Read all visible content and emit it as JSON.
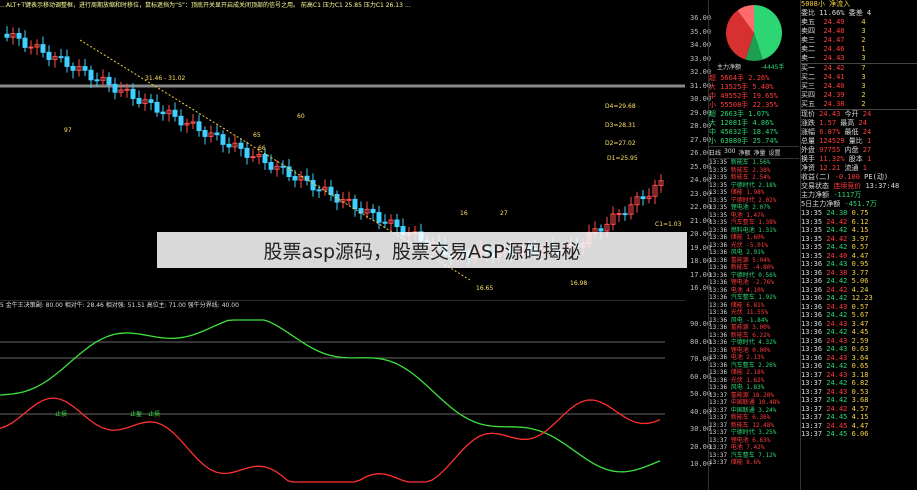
{
  "main_legend": "…ALT+T键表示移动调整框，进行周期放缩和时移位，鼠标遮挡为“S”：顶底开关显开启成关闭顶部的信号之用。 前高C1  压力C1 25.85  压力C1 26.13  …",
  "main_y_ticks": [
    "36.00",
    "35.00",
    "34.00",
    "33.00",
    "32.00",
    "31.00",
    "30.00",
    "29.00",
    "28.00",
    "27.00",
    "26.00",
    "25.00",
    "24.00",
    "23.00",
    "22.00",
    "21.00",
    "20.00",
    "19.00",
    "18.00",
    "17.00",
    "16.00"
  ],
  "main_annotations": [
    "31.46 - 31.02",
    "97",
    "66",
    "60",
    "65",
    "27",
    "16.65",
    "16",
    "16.98",
    "D4=29.68",
    "D3=28.31",
    "D2=27.02",
    "D1=25.95",
    "C1=1.03"
  ],
  "osc_legend": "5 金牛王决策副: 80.00  相对牛: 28.46  相对强: 51.51  高位主: 71.00  强牛分界线: 40.00",
  "osc_y_ticks": [
    "90.00",
    "80.00",
    "70.00",
    "60.00",
    "50.00",
    "40.00",
    "30.00",
    "20.00",
    "10.00"
  ],
  "osc_labels": [
    "止损",
    "止盈",
    "止损"
  ],
  "banner_text": "股票asp源码，股票交易ASP源码揭秘",
  "pie": {
    "labels": [
      "主力净额",
      "-4445手"
    ]
  },
  "flow": [
    {
      "k": "超",
      "v": "5664手",
      "p": "2.26%"
    },
    {
      "k": "大",
      "v": "13525手",
      "p": "5.40%"
    },
    {
      "k": "中",
      "v": "49552手",
      "p": "19.65%"
    },
    {
      "k": "小",
      "v": "55508手",
      "p": "22.35%"
    },
    {
      "k": "超",
      "v": "2663手",
      "p": "1.07%"
    },
    {
      "k": "大",
      "v": "12081手",
      "p": "4.86%"
    },
    {
      "k": "中",
      "v": "45832手",
      "p": "18.47%"
    },
    {
      "k": "小",
      "v": "63880手",
      "p": "25.74%"
    }
  ],
  "flow_tabs": [
    "日线",
    "300",
    "净额",
    "净量",
    "设置"
  ],
  "ticks": [
    {
      "t": "13:35",
      "v": "新能车",
      "p": "1.56%"
    },
    {
      "t": "13:35",
      "v": "新能车",
      "p": "2.38%"
    },
    {
      "t": "13:35",
      "v": "新能车",
      "p": "2.54%"
    },
    {
      "t": "13:35",
      "v": "宁德时代",
      "p": "2.18%"
    },
    {
      "t": "13:35",
      "v": "储能",
      "p": "1.98%"
    },
    {
      "t": "13:35",
      "v": "宁德时代",
      "p": "2.02%"
    },
    {
      "t": "13:35",
      "v": "锂电池",
      "p": "2.07%"
    },
    {
      "t": "13:35",
      "v": "电池",
      "p": "1.47%"
    },
    {
      "t": "13:35",
      "v": "汽车整车",
      "p": "1.38%"
    },
    {
      "t": "13:36",
      "v": "燃料电池",
      "p": "1.31%"
    },
    {
      "t": "13:36",
      "v": "储能",
      "p": "1.60%"
    },
    {
      "t": "13:36",
      "v": "光伏",
      "p": "-5.01%"
    },
    {
      "t": "13:36",
      "v": "风电",
      "p": "2.91%"
    },
    {
      "t": "13:36",
      "v": "氢能源",
      "p": "5.04%"
    },
    {
      "t": "13:36",
      "v": "新能车",
      "p": "-4.80%"
    },
    {
      "t": "13:36",
      "v": "宁德时代",
      "p": "0.56%"
    },
    {
      "t": "13:36",
      "v": "锂电池",
      "p": "-2.76%"
    },
    {
      "t": "13:36",
      "v": "电池",
      "p": "4.10%"
    },
    {
      "t": "13:36",
      "v": "汽车整车",
      "p": "1.92%"
    },
    {
      "t": "13:36",
      "v": "储能",
      "p": "6.81%"
    },
    {
      "t": "13:36",
      "v": "光伏",
      "p": "11.55%"
    },
    {
      "t": "13:36",
      "v": "风电",
      "p": "-1.84%"
    },
    {
      "t": "13:36",
      "v": "氢能源",
      "p": "3.00%"
    },
    {
      "t": "13:36",
      "v": "新能车",
      "p": "6.22%"
    },
    {
      "t": "13:36",
      "v": "宁德时代",
      "p": "4.32%"
    },
    {
      "t": "13:36",
      "v": "锂电池",
      "p": "0.00%"
    },
    {
      "t": "13:36",
      "v": "电池",
      "p": "2.13%"
    },
    {
      "t": "13:36",
      "v": "汽车整车",
      "p": "2.26%"
    },
    {
      "t": "13:36",
      "v": "储能",
      "p": "2.18%"
    },
    {
      "t": "13:36",
      "v": "光伏",
      "p": "1.62%"
    },
    {
      "t": "13:36",
      "v": "风电",
      "p": "1.83%"
    },
    {
      "t": "13:37",
      "v": "氢能源",
      "p": "18.20%"
    },
    {
      "t": "13:37",
      "v": "中国联通",
      "p": "10.48%"
    },
    {
      "t": "13:37",
      "v": "中国联通",
      "p": "3.24%"
    },
    {
      "t": "13:37",
      "v": "新能车",
      "p": "6.36%"
    },
    {
      "t": "13:37",
      "v": "新能车",
      "p": "12.48%"
    },
    {
      "t": "13:37",
      "v": "宁德时代",
      "p": "3.25%"
    },
    {
      "t": "13:37",
      "v": "锂电池",
      "p": "6.63%"
    },
    {
      "t": "13:37",
      "v": "电池",
      "p": "7.42%"
    },
    {
      "t": "13:37",
      "v": "汽车整车",
      "p": "7.12%"
    },
    {
      "t": "13:37",
      "v": "储能",
      "p": "8.6%"
    }
  ],
  "order_book": {
    "header": "5008小 净流入",
    "cmd": "委比  11.66%  委差  4",
    "sells": [
      {
        "k": "卖五",
        "p": "24.49",
        "v": "4"
      },
      {
        "k": "卖四",
        "p": "24.48",
        "v": "3"
      },
      {
        "k": "卖三",
        "p": "24.47",
        "v": "2"
      },
      {
        "k": "卖二",
        "p": "24.46",
        "v": "1"
      },
      {
        "k": "卖一",
        "p": "24.43",
        "v": "3"
      }
    ],
    "buys": [
      {
        "k": "买一",
        "p": "24.42",
        "v": "7"
      },
      {
        "k": "买二",
        "p": "24.41",
        "v": "3"
      },
      {
        "k": "买三",
        "p": "24.40",
        "v": "3"
      },
      {
        "k": "买四",
        "p": "24.39",
        "v": "2"
      },
      {
        "k": "买五",
        "p": "24.38",
        "v": "2"
      }
    ],
    "stats": [
      [
        "现价",
        "24.43",
        "今开",
        "24"
      ],
      [
        "涨跌",
        "1.57",
        "最高",
        "24"
      ],
      [
        "涨幅",
        "6.87%",
        "最低",
        "24"
      ],
      [
        "总量",
        "124529",
        "量比",
        "1"
      ],
      [
        "外盘",
        "97755",
        "内盘",
        "27"
      ],
      [
        "换手",
        "11.32%",
        "股本",
        "1"
      ],
      [
        "净资",
        "12.21",
        "流通",
        "1"
      ],
      [
        "收益(二)",
        "-0.100",
        "PE(动)",
        ""
      ],
      [
        "交易状态",
        "连续竞价",
        "13:37:48",
        ""
      ]
    ],
    "big_labels": [
      "主力净额",
      "5日主力净额"
    ],
    "big_vals": [
      "-1117万",
      "-451.7万"
    ],
    "trades": [
      [
        "13:35",
        "24.38",
        "0.75"
      ],
      [
        "13:35",
        "24.42",
        "6.12"
      ],
      [
        "13:35",
        "24.42",
        "4.15"
      ],
      [
        "13:35",
        "24.42",
        "3.97"
      ],
      [
        "13:35",
        "24.42",
        "0.57"
      ],
      [
        "13:35",
        "24.40",
        "4.47"
      ],
      [
        "13:36",
        "24.43",
        "0.95"
      ],
      [
        "13:36",
        "24.38",
        "3.77"
      ],
      [
        "13:36",
        "24.42",
        "5.06"
      ],
      [
        "13:36",
        "24.42",
        "4.24"
      ],
      [
        "13:36",
        "24.42",
        "12.23"
      ],
      [
        "13:36",
        "24.43",
        "0.57"
      ],
      [
        "13:36",
        "24.42",
        "5.67"
      ],
      [
        "13:36",
        "24.43",
        "3.47"
      ],
      [
        "13:36",
        "24.42",
        "4.45"
      ],
      [
        "13:36",
        "24.43",
        "2.59"
      ],
      [
        "13:36",
        "24.43",
        "0.63"
      ],
      [
        "13:36",
        "24.43",
        "3.64"
      ],
      [
        "13:36",
        "24.42",
        "0.65"
      ],
      [
        "13:37",
        "24.43",
        "3.18"
      ],
      [
        "13:37",
        "24.42",
        "6.82"
      ],
      [
        "13:37",
        "24.43",
        "0.53"
      ],
      [
        "13:37",
        "24.42",
        "3.68"
      ],
      [
        "13:37",
        "24.42",
        "4.57"
      ],
      [
        "13:37",
        "24.45",
        "4.15"
      ],
      [
        "13:37",
        "24.45",
        "4.47"
      ],
      [
        "13:37",
        "24.45",
        "6.06"
      ]
    ]
  },
  "colors": {
    "up": "#ff3b3b",
    "down": "#2ed573",
    "kline_up": "#ff4d4d",
    "kline_down": "#3fd0ff"
  }
}
